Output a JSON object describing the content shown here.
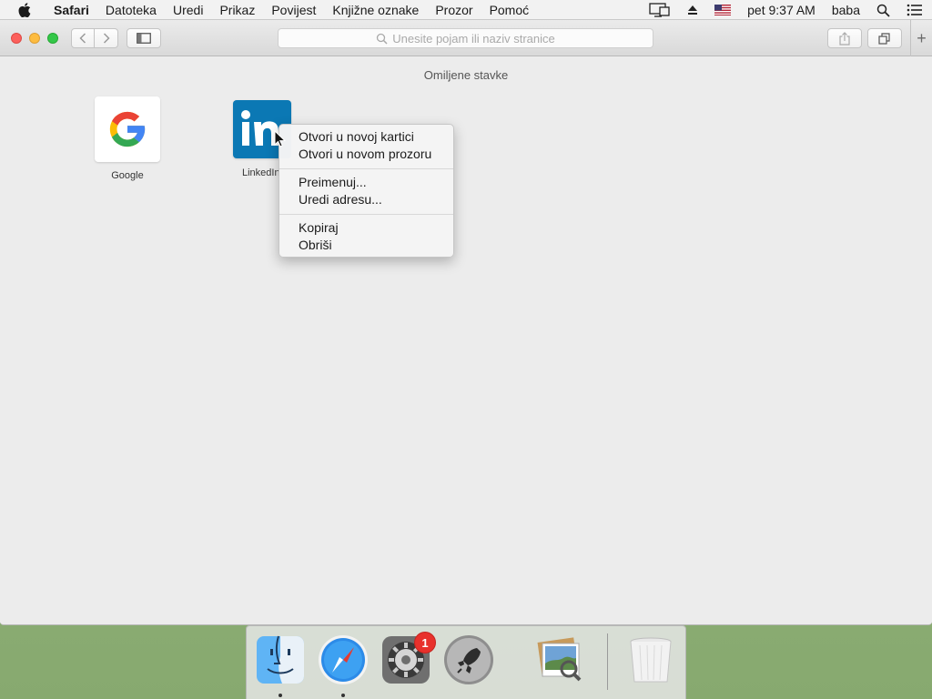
{
  "menubar": {
    "app_name": "Safari",
    "items": [
      "Datoteka",
      "Uredi",
      "Prikaz",
      "Povijest",
      "Knjižne oznake",
      "Prozor",
      "Pomoć"
    ],
    "clock": "pet 9:37 AM",
    "user": "baba"
  },
  "toolbar": {
    "address_placeholder": "Unesite pojam ili naziv stranice",
    "new_tab": "+"
  },
  "favorites": {
    "title": "Omiljene stavke",
    "items": [
      {
        "label": "Google"
      },
      {
        "label": "LinkedIn"
      }
    ]
  },
  "context_menu": {
    "items": [
      "Otvori u novoj kartici",
      "Otvori u novom prozoru",
      "Preimenuj...",
      "Uredi adresu...",
      "Kopiraj",
      "Obriši"
    ]
  },
  "dock": {
    "badge_count": "1",
    "apps": [
      "finder-icon",
      "safari-icon",
      "system-preferences-icon",
      "launchpad-icon",
      "preview-icon",
      "trash-icon"
    ]
  },
  "colors": {
    "linkedin_blue": "#0b78b4",
    "google_red": "#ea4335",
    "google_blue": "#4285f4",
    "google_green": "#34a853",
    "google_yellow": "#fbbc05",
    "badge_red": "#e8312c"
  }
}
